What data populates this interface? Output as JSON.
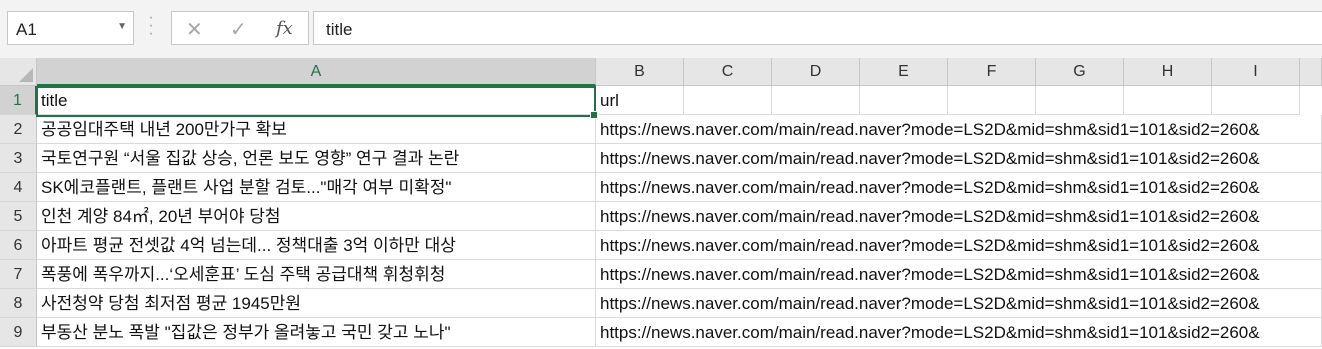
{
  "name_box": {
    "value": "A1"
  },
  "formula_bar": {
    "cancel_glyph": "✕",
    "enter_glyph": "✓",
    "fx_label": "fx",
    "content": "title"
  },
  "columns": [
    "A",
    "B",
    "C",
    "D",
    "E",
    "F",
    "G",
    "H",
    "I"
  ],
  "selected_column": "A",
  "rows": [
    {
      "num": "1",
      "title": "title",
      "url": "url"
    },
    {
      "num": "2",
      "title": "공공임대주택 내년 200만가구 확보",
      "url": "https://news.naver.com/main/read.naver?mode=LS2D&mid=shm&sid1=101&sid2=260&"
    },
    {
      "num": "3",
      "title": "국토연구원 “서울 집값 상승, 언론 보도 영향” 연구 결과 논란",
      "url": "https://news.naver.com/main/read.naver?mode=LS2D&mid=shm&sid1=101&sid2=260&"
    },
    {
      "num": "4",
      "title": "SK에코플랜트, 플랜트 사업 분할 검토...\"매각 여부 미확정\"",
      "url": "https://news.naver.com/main/read.naver?mode=LS2D&mid=shm&sid1=101&sid2=260&"
    },
    {
      "num": "5",
      "title": "인천 계양 84㎡, 20년 부어야 당첨",
      "url": "https://news.naver.com/main/read.naver?mode=LS2D&mid=shm&sid1=101&sid2=260&"
    },
    {
      "num": "6",
      "title": "아파트 평균 전셋값 4억 넘는데... 정책대출 3억 이하만 대상",
      "url": "https://news.naver.com/main/read.naver?mode=LS2D&mid=shm&sid1=101&sid2=260&"
    },
    {
      "num": "7",
      "title": "폭풍에 폭우까지...‘오세훈표’ 도심 주택 공급대책 휘청휘청",
      "url": "https://news.naver.com/main/read.naver?mode=LS2D&mid=shm&sid1=101&sid2=260&"
    },
    {
      "num": "8",
      "title": "사전청약 당첨 최저점 평균 1945만원",
      "url": "https://news.naver.com/main/read.naver?mode=LS2D&mid=shm&sid1=101&sid2=260&"
    },
    {
      "num": "9",
      "title": "부동산 분노 폭발 \"집값은 정부가 올려놓고 국민 갖고 노나\"",
      "url": "https://news.naver.com/main/read.naver?mode=LS2D&mid=shm&sid1=101&sid2=260&"
    }
  ],
  "selected_row": "1",
  "colors": {
    "accent": "#217346",
    "header_bg": "#e6e6e6",
    "grid_line": "#dadada"
  }
}
